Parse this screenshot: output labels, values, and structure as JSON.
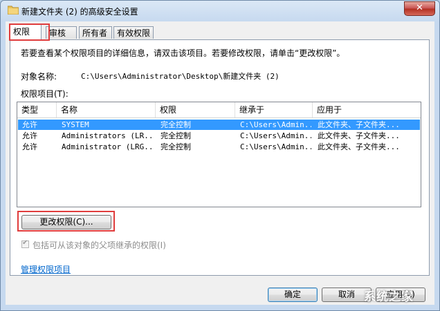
{
  "window": {
    "title": "新建文件夹 (2) 的高级安全设置",
    "close_label": "✕"
  },
  "tabs": [
    {
      "label": "权限",
      "active": true
    },
    {
      "label": "审核",
      "active": false
    },
    {
      "label": "所有者",
      "active": false
    },
    {
      "label": "有效权限",
      "active": false
    }
  ],
  "info_text": "若要查看某个权限项目的详细信息，请双击该项目。若要修改权限，请单击“更改权限”。",
  "object_name": {
    "label": "对象名称:",
    "value": "C:\\Users\\Administrator\\Desktop\\新建文件夹 (2)"
  },
  "entries_label": "权限项目(T):",
  "table": {
    "columns": [
      "类型",
      "名称",
      "权限",
      "继承于",
      "应用于"
    ],
    "rows": [
      {
        "type": "允许",
        "name": "SYSTEM",
        "permission": "完全控制",
        "inherited": "C:\\Users\\Admin...",
        "applies": "此文件夹、子文件夹...",
        "selected": true
      },
      {
        "type": "允许",
        "name": "Administrators (LR...",
        "permission": "完全控制",
        "inherited": "C:\\Users\\Admin...",
        "applies": "此文件夹、子文件夹...",
        "selected": false
      },
      {
        "type": "允许",
        "name": "Administrator (LRG...",
        "permission": "完全控制",
        "inherited": "C:\\Users\\Admin...",
        "applies": "此文件夹、子文件夹...",
        "selected": false
      }
    ]
  },
  "change_permissions_label": "更改权限(C)...",
  "inherit_checkbox": {
    "label": "包括可从该对象的父项继承的权限(I)",
    "checked": true,
    "enabled": false
  },
  "manage_link": "管理权限项目",
  "buttons": {
    "ok": "确定",
    "cancel": "取消",
    "apply": "应用(A)"
  },
  "watermark": "系统之家",
  "colors": {
    "highlight_border": "#e03c3c",
    "selection": "#3399ff",
    "link": "#0066cc"
  }
}
